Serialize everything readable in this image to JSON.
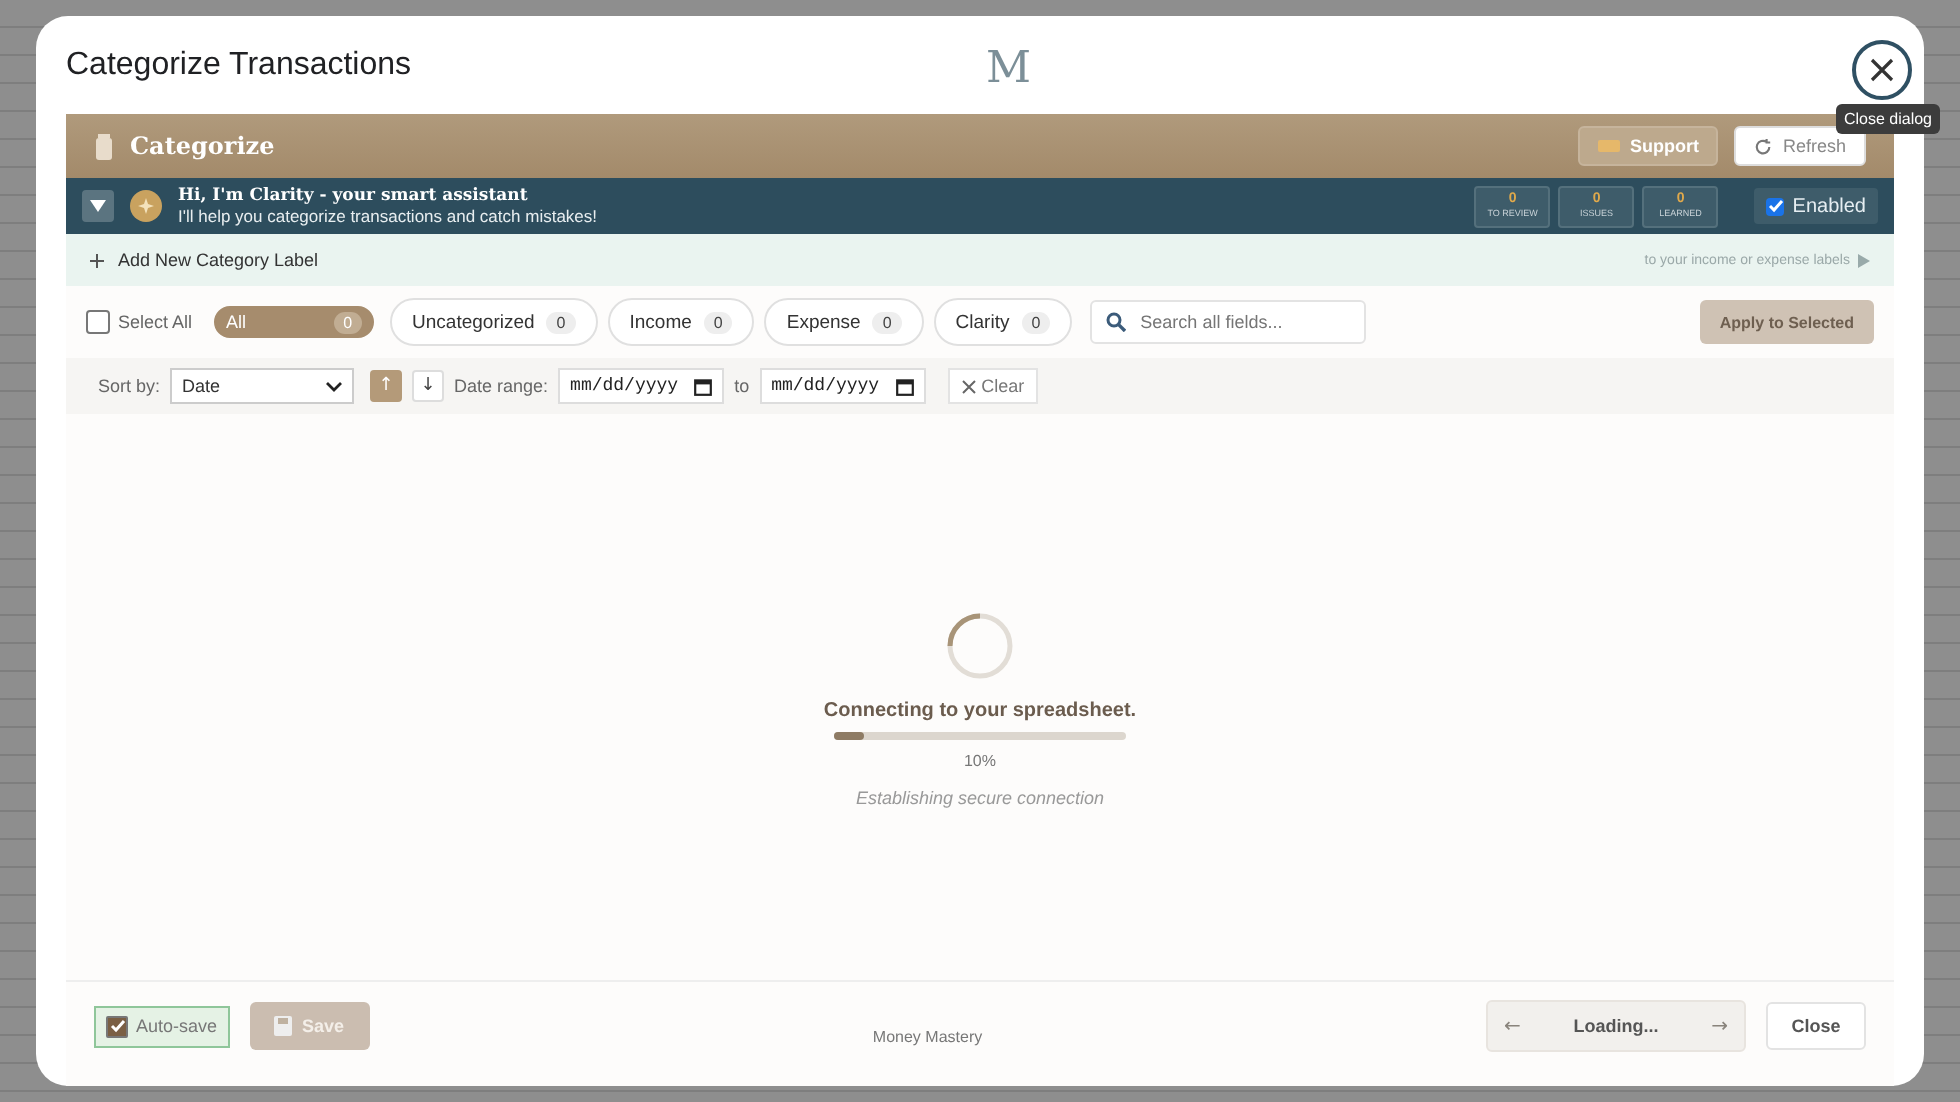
{
  "window": {
    "title": "Categorize Transactions",
    "logo": "M",
    "close_tooltip": "Close dialog"
  },
  "header": {
    "title": "Categorize",
    "buttons": [
      {
        "label": "Support",
        "kind": "support"
      },
      {
        "label": "Refresh",
        "kind": "refresh"
      }
    ]
  },
  "assistant": {
    "expanded": false,
    "greeting": "Hi, I'm Clarity - your smart assistant",
    "subtitle": "I'll help you categorize transactions and catch mistakes!",
    "stats": [
      {
        "value": "0",
        "label": "TO REVIEW"
      },
      {
        "value": "0",
        "label": "ISSUES"
      },
      {
        "value": "0",
        "label": "LEARNED"
      }
    ],
    "enabled": {
      "label": "Enabled",
      "checked": true
    }
  },
  "add_category": {
    "label": "Add New Category Label",
    "hint": "to your income or expense labels"
  },
  "filters": {
    "select_all": {
      "label": "Select All",
      "checked": false
    },
    "chips": [
      {
        "label": "All",
        "count": "0",
        "selected": true
      },
      {
        "label": "Uncategorized",
        "count": "0",
        "selected": false
      },
      {
        "label": "Income",
        "count": "0",
        "selected": false
      },
      {
        "label": "Expense",
        "count": "0",
        "selected": false
      },
      {
        "label": "Clarity",
        "count": "0",
        "selected": false
      }
    ],
    "search": {
      "placeholder": "Search all fields..."
    },
    "apply": {
      "label": "Apply to Selected",
      "disabled": true
    }
  },
  "sort": {
    "label": "Sort by:",
    "value": "Date",
    "directions": [
      {
        "symbol": "↑",
        "selected": true
      },
      {
        "symbol": "↓",
        "selected": false
      }
    ],
    "date_range_label": "Date range:",
    "from": {
      "placeholder": "mm/dd/yyyy"
    },
    "to_label": "to",
    "to": {
      "placeholder": "mm/dd/yyyy"
    },
    "clear": "Clear"
  },
  "loading": {
    "message": "Connecting to your spreadsheet.",
    "level": 0.1,
    "percent": "10%",
    "detail": "Establishing secure connection"
  },
  "footer": {
    "autosave": {
      "label": "Auto-save",
      "checked": true
    },
    "save": {
      "label": "Save",
      "disabled": true
    },
    "brand": "Money Mastery",
    "pager": {
      "prev": "←",
      "label": "Loading...",
      "next": "→"
    },
    "close": "Close"
  }
}
